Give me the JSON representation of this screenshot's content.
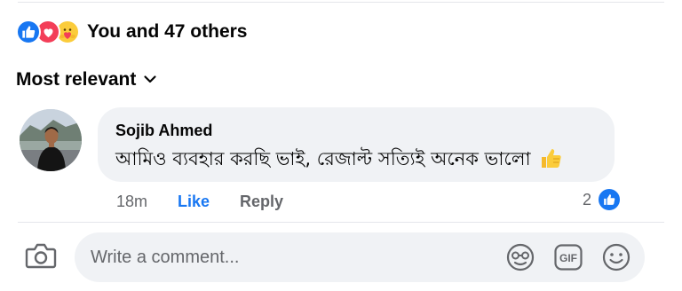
{
  "reactions": {
    "summary": "You and 47 others",
    "icons": [
      "like-icon",
      "love-icon",
      "care-icon"
    ],
    "colors": {
      "like": "#1877f2",
      "love": "#f33e58",
      "care": "#fbcc3b"
    }
  },
  "sort": {
    "label": "Most relevant",
    "icon": "chevron-down-icon"
  },
  "comment": {
    "author": "Sojib Ahmed",
    "text": "আমিও ব্যবহার করছি ভাই, রেজাল্ট সত্যিই অনেক ভালো",
    "emoji": "thumbs-up-emoji",
    "time": "18m",
    "like_label": "Like",
    "reply_label": "Reply",
    "like_count": "2"
  },
  "composer": {
    "placeholder": "Write a comment...",
    "icons": [
      "camera-icon",
      "sticker-icon",
      "gif-icon",
      "emoji-icon"
    ]
  },
  "colors": {
    "accent": "#1877f2",
    "muted_text": "#65676b",
    "bubble_bg": "#f0f2f5"
  }
}
